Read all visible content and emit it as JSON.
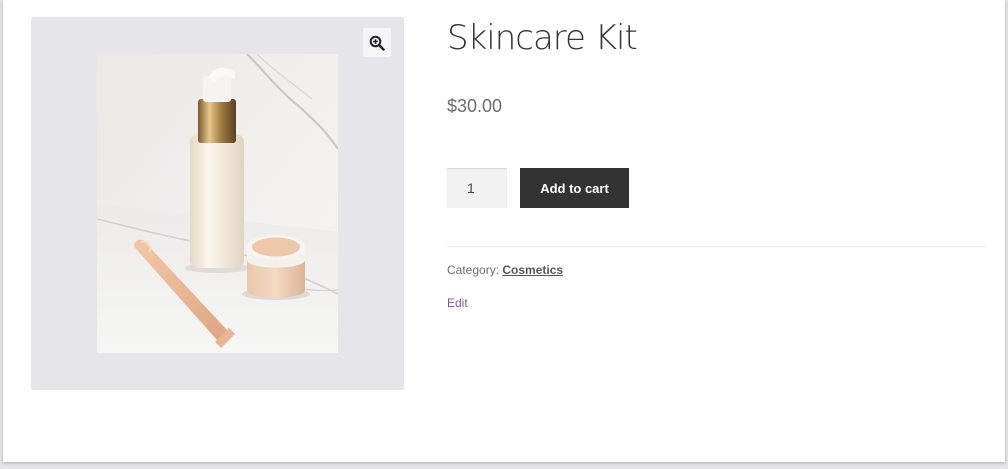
{
  "product": {
    "title": "Skincare Kit",
    "price": "$30.00",
    "quantity": "1",
    "add_to_cart_label": "Add to cart",
    "category_label": "Category:",
    "category_value": "Cosmetics",
    "edit_label": "Edit"
  },
  "gallery": {
    "zoom_icon": "magnifier-plus-icon",
    "image_subject": "skincare pump bottle, tube and cream jar on marble"
  },
  "colors": {
    "button_bg": "#333333",
    "gallery_bg": "#e6e6ea",
    "edit_link": "#7f54b3"
  }
}
